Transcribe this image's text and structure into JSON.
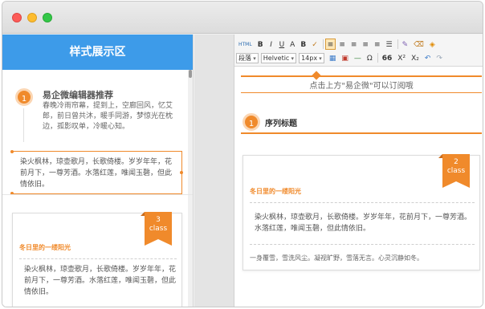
{
  "window": {
    "controls": [
      "close",
      "minimize",
      "zoom"
    ]
  },
  "preview": {
    "header": "样式展示区",
    "recommend": {
      "number": "1",
      "title": "易企微编辑器推荐",
      "text": "春晚冷雨帘幕，提到上，空廊回风，忆艾郎，前日曾共沐，暖手同游，梦惊光在枕边，孤影叹单，冷暖心知。"
    },
    "framed_text": "染火枫林，琼壶歌月，长歌倚楼。岁岁年年，花前月下，一尊芳酒。水落红莲，唯闻玉磬，但此情依旧。",
    "card": {
      "badge_number": "3",
      "badge_label": "class",
      "title": "冬日里的一缕阳光",
      "text": "染火枫林，琼壶歌月，长歌倚楼。岁岁年年，花前月下，一尊芳酒。水落红莲，唯闻玉磬，但此情依旧。"
    }
  },
  "editor": {
    "toolbar": {
      "row1": [
        "HTML",
        "B",
        "I",
        "U",
        "A",
        "B",
        "✓",
        "≡",
        "≡",
        "≡",
        "≡",
        "≡",
        "☰",
        "✎",
        "⌫",
        "◈"
      ],
      "font_family": "Helvetic",
      "paragraph": "段落",
      "font_size": "14px",
      "row2_tail": [
        "Ω",
        "66",
        "X²",
        "X₂",
        "↶",
        "↷"
      ]
    },
    "subscribe_text": "点击上方\"易企微\"可以订阅哦",
    "sequence": {
      "number": "1",
      "title": "序列标题"
    },
    "card": {
      "badge_number": "2",
      "badge_label": "class",
      "title": "冬日里的一缕阳光",
      "text": "染火枫林，琼壶歌月，长歌倚楼。岁岁年年，花前月下，一尊芳酒。水落红莲，唯闻玉磬，但此情依旧。",
      "footer": "一身覆雪，雪洗风尘。凝视旷野，雪落无言。心灵沉静如冬。"
    }
  },
  "colors": {
    "accent_orange": "#f08a2b",
    "header_blue": "#3d9be9"
  }
}
